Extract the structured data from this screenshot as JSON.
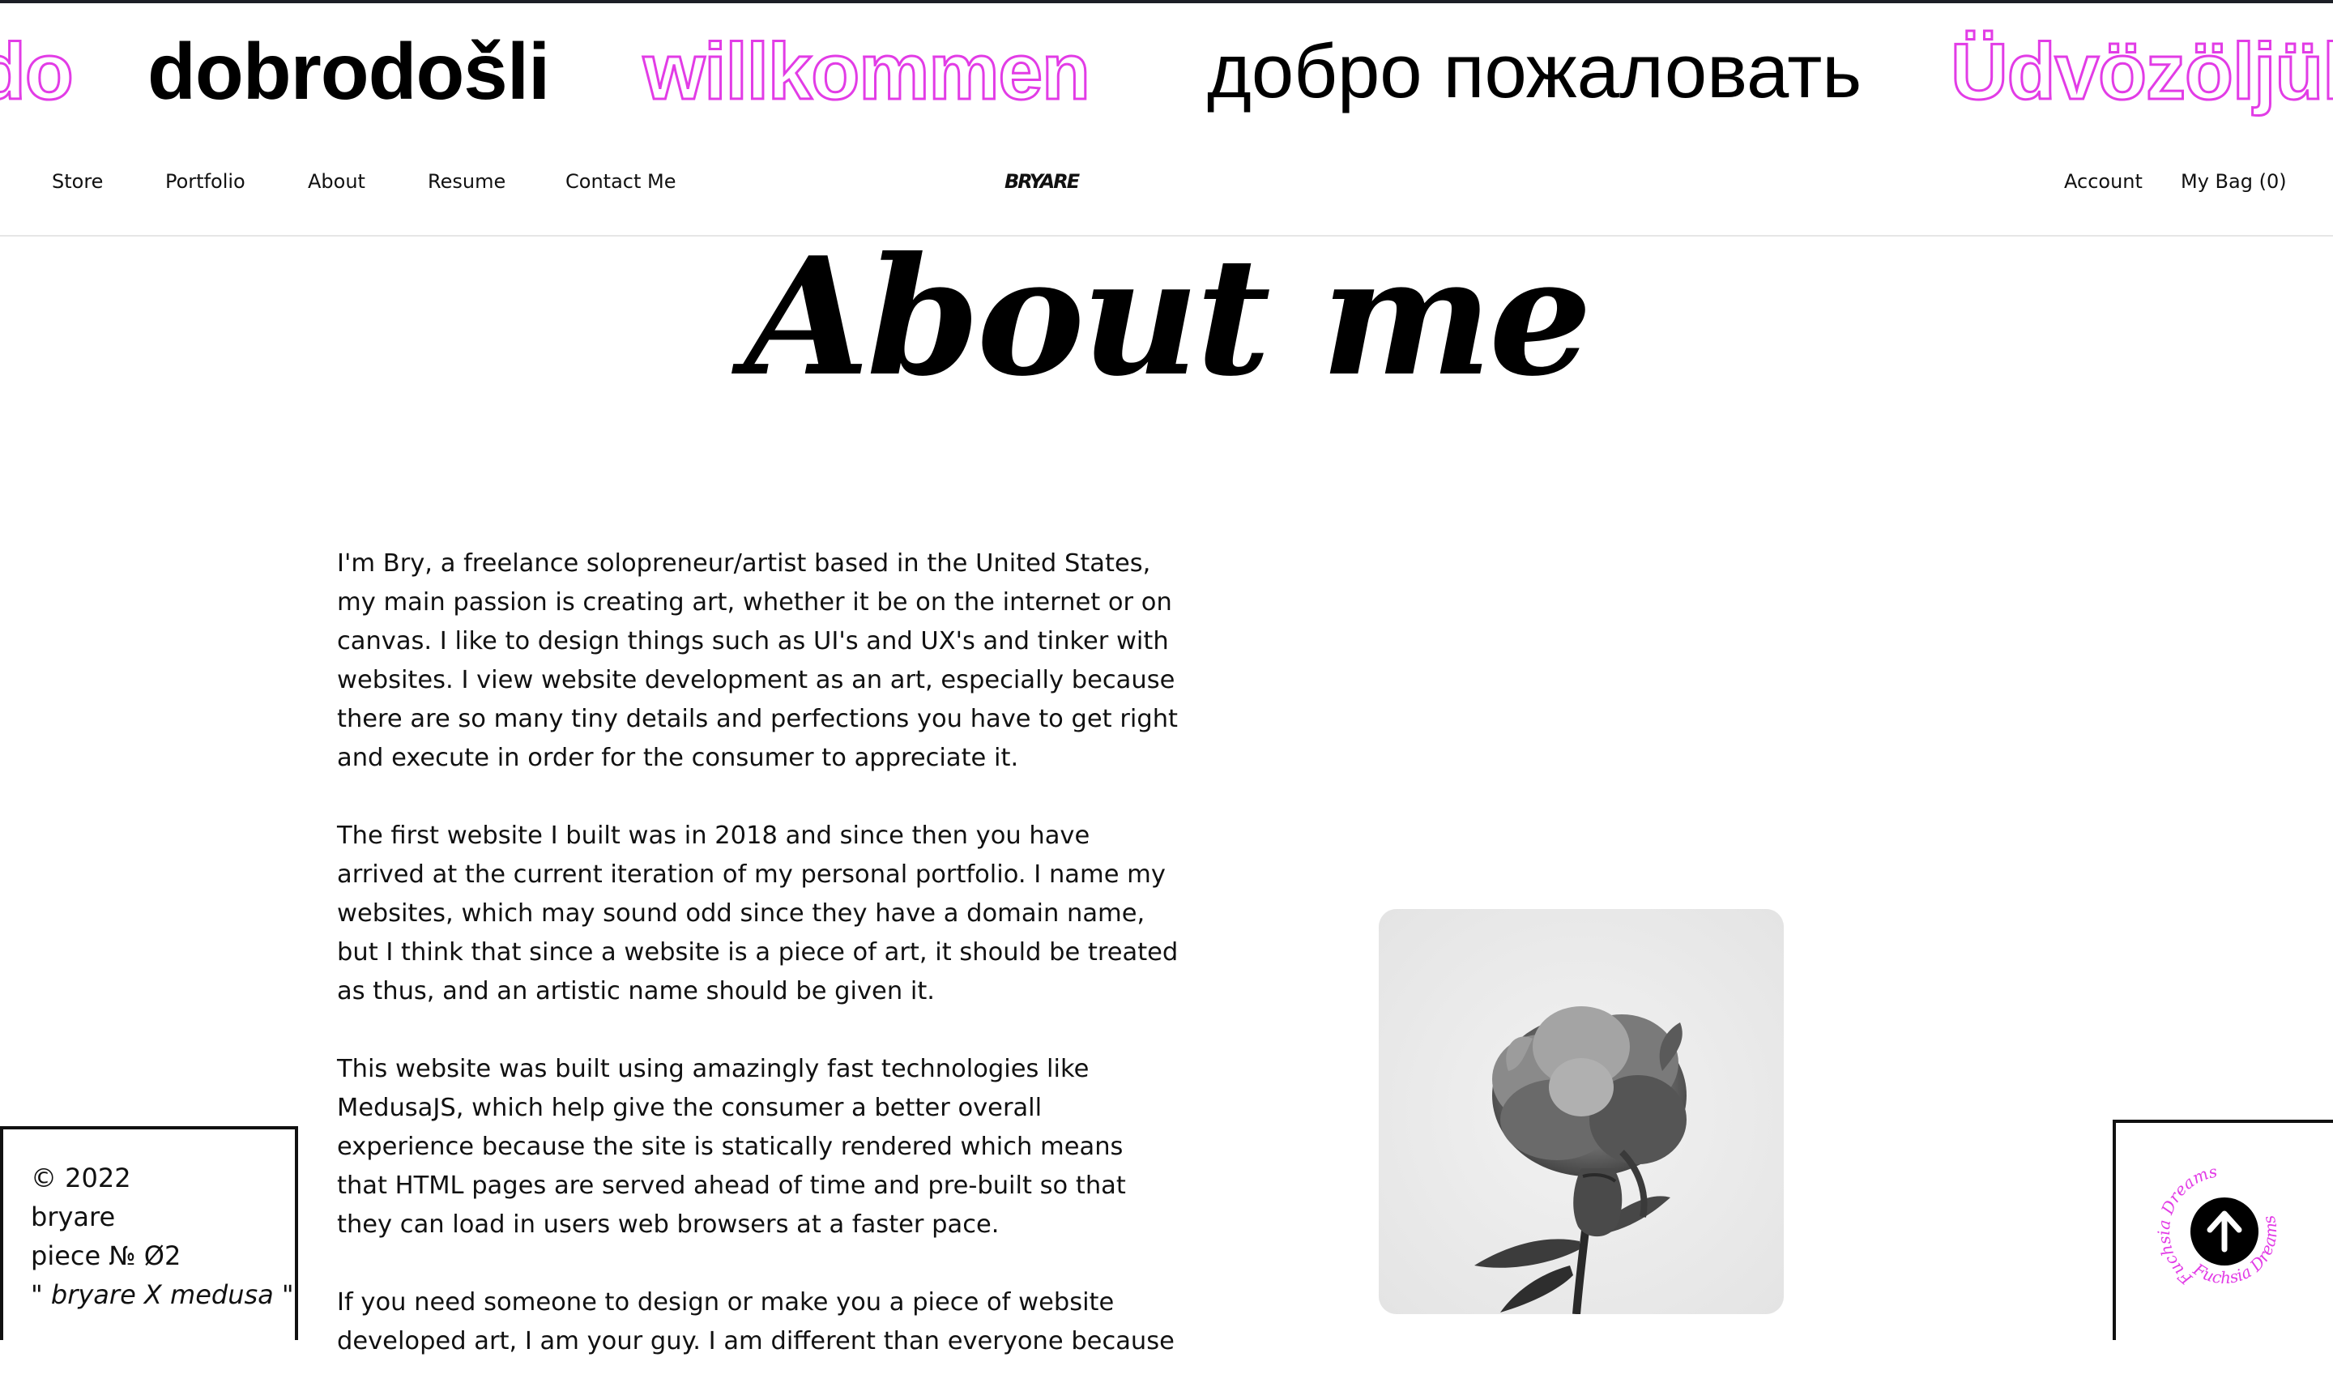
{
  "marquee": {
    "words": [
      "do",
      "dobrodošli",
      "willkommen",
      "добро пожаловать",
      "Üdvözöljük"
    ]
  },
  "nav": {
    "links": [
      "Store",
      "Portfolio",
      "About",
      "Resume",
      "Contact Me"
    ],
    "brand": "BRYARE",
    "account": "Account",
    "bag": "My Bag (0)"
  },
  "page": {
    "title": "About me"
  },
  "content": {
    "paragraphs": [
      "I'm Bry, a freelance solopreneur/artist based in the United States, my main passion is creating art, whether it be on the internet or on canvas. I like to design things such as UI's and UX's and tinker with websites. I view website development as an art, especially because there are so many tiny details and perfections you have to get right and execute in order for the consumer to appreciate it.",
      "The first website I built was in 2018 and since then you have arrived at the current iteration of my personal portfolio. I name my websites, which may sound odd since they have a domain name, but I think that since a website is a piece of art, it should be treated as thus, and an artistic name should be given it.",
      "This website was built using amazingly fast technologies like MedusaJS, which help give the consumer a better overall experience because the site is statically rendered which means that HTML pages are served ahead of time and pre-built so that they can load in users web browsers at a faster pace.",
      "If you need someone to design or make you a piece of website developed art, I am your guy. I am different than everyone because"
    ]
  },
  "footer_box": {
    "copyright": "© 2022",
    "name": "bryare",
    "piece": "piece № Ø2",
    "quote": "\" bryare X medusa \""
  },
  "scroll_badge": {
    "ring_text": "Fuchsia Dreams",
    "ring_color": "#e23ce6",
    "icon": "arrow-up-icon"
  },
  "colors": {
    "accent": "#e23ce6",
    "brand": "#151b2b"
  }
}
